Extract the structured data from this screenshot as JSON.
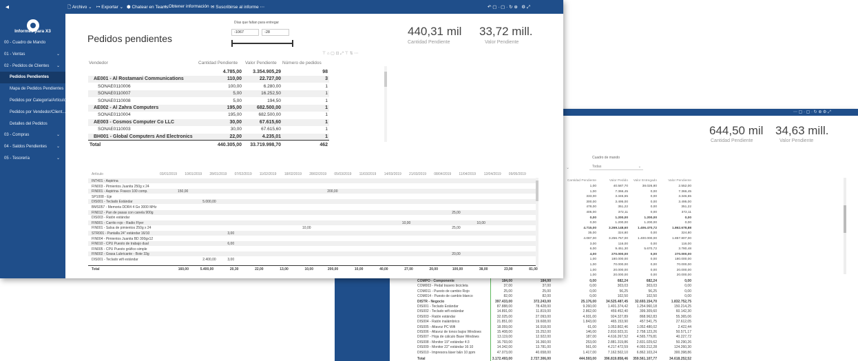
{
  "toolbar": {
    "items": [
      "Archivo",
      "Exportar",
      "Chatear en Teams",
      "Obtener información",
      "Suscribirse al informe"
    ]
  },
  "sidebar": {
    "app_title": "Informes para X3",
    "items": [
      {
        "label": "00 - Cuadro de Mando",
        "sub": false,
        "active": false,
        "chevron": false
      },
      {
        "label": "01 - Ventas",
        "sub": false,
        "active": false,
        "chevron": true
      },
      {
        "label": "02 - Pedidos de Clientes",
        "sub": false,
        "active": false,
        "chevron": true
      },
      {
        "label": "Pedidos Pendientes",
        "sub": true,
        "active": true,
        "chevron": false
      },
      {
        "label": "Mapa de Pedidos Pendientes",
        "sub": true,
        "active": false,
        "chevron": false
      },
      {
        "label": "Pedidos por Categoría/Artículo",
        "sub": true,
        "active": false,
        "chevron": false
      },
      {
        "label": "Pedidos por Vendedor/Client...",
        "sub": true,
        "active": false,
        "chevron": false
      },
      {
        "label": "Detalles del Pedidos",
        "sub": true,
        "active": false,
        "chevron": false
      },
      {
        "label": "03 - Compras",
        "sub": false,
        "active": false,
        "chevron": true
      },
      {
        "label": "04 - Saldos Pendientes",
        "sub": false,
        "active": false,
        "chevron": true
      },
      {
        "label": "05 - Tesorería",
        "sub": false,
        "active": false,
        "chevron": true
      }
    ]
  },
  "report": {
    "title": "Pedidos pendientes",
    "slider": {
      "label": "Días que faltan para entregar",
      "min": "-1067",
      "max": "-28"
    },
    "kpis": [
      {
        "value": "440,31 mil",
        "label": "Cantidad Pendiente"
      },
      {
        "value": "33,72 mill.",
        "label": "Valor Pendiente"
      }
    ],
    "table": {
      "headers": [
        "Vendedor",
        "Cantidad Pendiente",
        "Valor Pendiente",
        "Número de pedidos"
      ],
      "rows": [
        {
          "name": "",
          "qty": "4.785,00",
          "value": "3.354.905,29",
          "orders": "98",
          "bold": true,
          "indent": false
        },
        {
          "name": "AE001 - Al Rostamani Communications",
          "qty": "110,00",
          "value": "22.727,00",
          "orders": "3",
          "bold": true,
          "indent": false
        },
        {
          "name": "SONAE0110006",
          "qty": "100,00",
          "value": "6.280,00",
          "orders": "1",
          "bold": false,
          "indent": true
        },
        {
          "name": "SONAE0110007",
          "qty": "5,00",
          "value": "16.252,50",
          "orders": "1",
          "bold": false,
          "indent": true
        },
        {
          "name": "SONAE0110008",
          "qty": "5,00",
          "value": "194,50",
          "orders": "1",
          "bold": false,
          "indent": true
        },
        {
          "name": "AE002 - Al Zahra Computers",
          "qty": "195,00",
          "value": "682.500,00",
          "orders": "1",
          "bold": true,
          "indent": false
        },
        {
          "name": "SONAE0110004",
          "qty": "195,00",
          "value": "682.500,00",
          "orders": "1",
          "bold": false,
          "indent": true
        },
        {
          "name": "AE003 - Cosmos Computer Co LLC",
          "qty": "30,00",
          "value": "67.615,60",
          "orders": "1",
          "bold": true,
          "indent": false
        },
        {
          "name": "SONAE0110003",
          "qty": "30,00",
          "value": "67.615,60",
          "orders": "1",
          "bold": false,
          "indent": true
        },
        {
          "name": "BH001 - Global Computers And Electronics",
          "qty": "22,00",
          "value": "4.235,01",
          "orders": "1",
          "bold": true,
          "indent": false
        }
      ],
      "total": {
        "label": "Total",
        "qty": "440.305,00",
        "value": "33.719.998,70",
        "orders": "462"
      }
    },
    "matrix": {
      "header": "Artículo",
      "dates": [
        "03/01/2019",
        "10/01/2019",
        "28/01/2019",
        "07/02/2019",
        "11/02/2019",
        "18/02/2019",
        "28/02/2019",
        "05/03/2019",
        "11/03/2019",
        "14/03/2019",
        "21/03/2019",
        "08/04/2019",
        "11/04/2019",
        "12/04/2019",
        "09/05/2019"
      ],
      "rows": [
        {
          "label": "INT401 - Aspirina",
          "cells": []
        },
        {
          "label": "FIN003 - Pimientos Juanita 250g x 24",
          "cells": []
        },
        {
          "label": "FIN001 - Aspirina- Frasco 100 comp.",
          "cells": [
            {
              "col": 0,
              "v": "150,00"
            },
            {
              "col": 6,
              "v": "200,00"
            }
          ]
        },
        {
          "label": "SP1008 - Eje",
          "cells": []
        },
        {
          "label": "DIS001 - Teclado Estándar",
          "cells": [
            {
              "col": 1,
              "v": "5.000,00"
            }
          ]
        },
        {
          "label": "BMS057 - Memoria DDR4 4 Go 3000 MHz",
          "cells": []
        },
        {
          "label": "FIN012 - Pan de pasas con canela 900g",
          "cells": [
            {
              "col": 11,
              "v": "25,00"
            }
          ]
        },
        {
          "label": "DIS003 - Ratón estándar",
          "cells": []
        },
        {
          "label": "FIN901 - Carrito rojo - Radio Flyer",
          "cells": [
            {
              "col": 9,
              "v": "10,00"
            },
            {
              "col": 12,
              "v": "10,00"
            }
          ]
        },
        {
          "label": "FIN001 - Salsa de pimientos 250g x 24",
          "cells": [
            {
              "col": 5,
              "v": "10,00"
            },
            {
              "col": 11,
              "v": "25,00"
            }
          ]
        },
        {
          "label": "STR001 - Pantalla 24\" estándar 16/10",
          "cells": [
            {
              "col": 2,
              "v": "3,00"
            }
          ]
        },
        {
          "label": "FIN004 - Pimientos Juanita BD 300gx12",
          "cells": []
        },
        {
          "label": "FIN010 - CPU Puesto de trabajo dual",
          "cells": [
            {
              "col": 2,
              "v": "6,00"
            }
          ]
        },
        {
          "label": "FIN005 - CPU Puesto gráfico simple",
          "cells": []
        },
        {
          "label": "FIN002 - Grasa Lubricante - Bote 33g",
          "cells": [
            {
              "col": 11,
              "v": "20,00"
            }
          ]
        },
        {
          "label": "DIS001 - Teclado wifi estándar",
          "cells": [
            {
              "col": 1,
              "v": "2.400,00"
            },
            {
              "col": 2,
              "v": "3,00"
            }
          ]
        }
      ],
      "total": {
        "label": "Total",
        "values": [
          "160,00",
          "5.400,00",
          "20,30",
          "22,00",
          "13,00",
          "10,00",
          "200,00",
          "10,00",
          "40,00",
          "27,00",
          "20,00",
          "100,00",
          "38,00",
          "23,90",
          "81,00"
        ]
      }
    }
  },
  "back_report": {
    "kpis": [
      {
        "value": "644,50 mil",
        "label": "Cantidad Pendiente"
      },
      {
        "value": "34,63 mill.",
        "label": "Valor Pendiente"
      }
    ],
    "filter_label": "Cuadro de mando",
    "filter_value": "Todas",
    "headers": [
      "Cantidad Pendiente",
      "Valor Pedido",
      "Valor Entregado",
      "Valor Pendiente"
    ],
    "rows": [
      {
        "c": [
          "1,00",
          "40.587,70",
          "38.026,80",
          "2.552,00"
        ],
        "b": false
      },
      {
        "c": [
          "1,00",
          "7.366,45",
          "0,00",
          "7.366,45"
        ],
        "b": false
      },
      {
        "c": [
          "333,00",
          "3.346,65",
          "0,00",
          "3.346,65"
        ],
        "b": false
      },
      {
        "c": [
          "300,00",
          "3.495,00",
          "0,00",
          "3.495,00"
        ],
        "b": false
      },
      {
        "c": [
          "478,00",
          "351,22",
          "0,00",
          "351,22"
        ],
        "b": false
      },
      {
        "c": [
          "405,00",
          "372,11",
          "0,00",
          "372,11"
        ],
        "b": false
      },
      {
        "c": [
          "0,00",
          "1.200,00",
          "1.200,00",
          "0,00"
        ],
        "b": true
      },
      {
        "c": [
          "0,00",
          "1.200,00",
          "1.200,00",
          "0,00"
        ],
        "b": false
      },
      {
        "c": [
          "4.715,00",
          "3.269.148,60",
          "1.406.470,72",
          "1.862.678,88"
        ],
        "b": true
      },
      {
        "c": [
          "35,00",
          "324,80",
          "0,00",
          "324,80"
        ],
        "b": false
      },
      {
        "c": [
          "4.087,00",
          "3.256.757,00",
          "1.400.000,00",
          "1.857.807,00"
        ],
        "b": false
      },
      {
        "c": [
          "3,00",
          "116,00",
          "0,00",
          "116,00"
        ],
        "b": false
      },
      {
        "c": [
          "6,00",
          "9.451,30",
          "5.670,72",
          "3.780,48"
        ],
        "b": false
      },
      {
        "c": [
          "4,00",
          "270.000,00",
          "0,00",
          "270.000,00"
        ],
        "b": true
      },
      {
        "c": [
          "1,00",
          "180.000,00",
          "0,00",
          "180.000,00"
        ],
        "b": false
      },
      {
        "c": [
          "1,00",
          "70.000,00",
          "0,00",
          "70.000,00"
        ],
        "b": false
      },
      {
        "c": [
          "1,00",
          "20.000,00",
          "0,00",
          "20.000,00"
        ],
        "b": false
      },
      {
        "c": [
          "1,00",
          "20.000,00",
          "0,00",
          "20.000,00"
        ],
        "b": false
      }
    ]
  },
  "detail": {
    "rows": [
      {
        "label": "COMPO - Componente",
        "a": "184,00",
        "b": "184,00",
        "c": [
          "0,00",
          "682,24",
          "682,24",
          "0,00"
        ],
        "bold": true
      },
      {
        "label": "COM003 - Pedal trasero bicicleta",
        "a": "37,00",
        "b": "37,00",
        "c": [
          "0,00",
          "303,03",
          "303,03",
          "0,00"
        ],
        "bold": false
      },
      {
        "label": "COM011 - Puesto de cambio Rojo",
        "a": "25,00",
        "b": "25,00",
        "c": [
          "0,00",
          "56,25",
          "56,25",
          "0,00"
        ],
        "bold": false
      },
      {
        "label": "COM014 - Puesto de cambio blanco",
        "a": "82,00",
        "b": "82,00",
        "c": [
          "0,00",
          "102,50",
          "102,50",
          "0,00"
        ],
        "bold": false
      },
      {
        "label": "DISTR - Negocio",
        "a": "397.433,00",
        "b": "372.243,00",
        "c": [
          "25.176,00",
          "34.525.487,45",
          "32.693.154,70",
          "1.832.752,75"
        ],
        "bold": true
      },
      {
        "label": "DIS001 - Teclado Estándar",
        "a": "87.888,00",
        "b": "78.428,00",
        "c": [
          "9.260,00",
          "1.401.374,42",
          "1.254.960,18",
          "150.214,25"
        ],
        "bold": false
      },
      {
        "label": "DIS002 - Teclado wifi estándar",
        "a": "14.891,00",
        "b": "11.819,00",
        "c": [
          "2.862,00",
          "459.452,40",
          "399.309,60",
          "60.142,30"
        ],
        "bold": false
      },
      {
        "label": "DIS003 - Ratón estándar",
        "a": "32.025,00",
        "b": "27.093,00",
        "c": [
          "4.931,00",
          "924.327,89",
          "868.962,83",
          "55.365,06"
        ],
        "bold": false
      },
      {
        "label": "DIS004 - Ratón inalámbrico",
        "a": "21.851,00",
        "b": "19.608,00",
        "c": [
          "1.843,00",
          "465.153,90",
          "457.541,75",
          "27.612,05"
        ],
        "bold": false
      },
      {
        "label": "DIS005 - Altavoz PC Wifi",
        "a": "18.059,00",
        "b": "16.918,00",
        "c": [
          "61,00",
          "1.053.802,46",
          "1.052.480,02",
          "2.422,44"
        ],
        "bold": false
      },
      {
        "label": "DIS006 - Altavoz de tonos bajos Windows",
        "a": "15.408,00",
        "b": "15.252,00",
        "c": [
          "146,00",
          "2.810.923,31",
          "2.758.123,26",
          "50.571,17"
        ],
        "bold": false
      },
      {
        "label": "DIS007 - Hoja de cálculo Base Windows",
        "a": "13.119,00",
        "b": "12.922,00",
        "c": [
          "187,00",
          "4.616.267,52",
          "4.565.779,81",
          "40.227,72"
        ],
        "bold": false
      },
      {
        "label": "DIS008 - Monitor 19\" estándar 4:3",
        "a": "16.793,00",
        "b": "16.360,00",
        "c": [
          "253,00",
          "2.881.319,86",
          "2.831.029,62",
          "50.290,26"
        ],
        "bold": false
      },
      {
        "label": "DIS009 - Monitor 22\" estándar 16:10",
        "a": "14.342,00",
        "b": "13.781,00",
        "c": [
          "561,00",
          "4.217.472,59",
          "4.093.212,28",
          "124.260,30"
        ],
        "bold": false
      },
      {
        "label": "DIS010 - Impresora láser b&n 10 ppm",
        "a": "47.073,00",
        "b": "40.658,00",
        "c": [
          "1.417,00",
          "7.162.502,10",
          "6.862.103,24",
          "300.398,86"
        ],
        "bold": false
      }
    ],
    "total": {
      "label": "Total",
      "a": "3.172.493,00",
      "b": "2.727.306,00",
      "c": [
        "444.593,00",
        "396.819.858,46",
        "359.561.107,77",
        "34.618.252,52"
      ]
    }
  }
}
